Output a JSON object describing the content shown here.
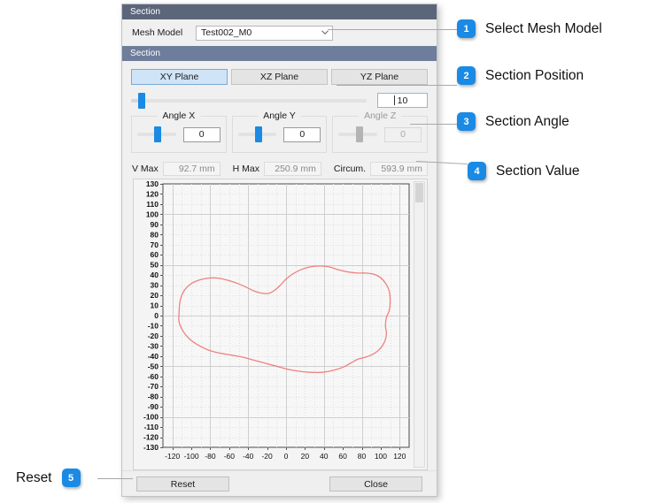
{
  "dialog": {
    "header_1": "Section",
    "header_2": "Section",
    "mesh_model": {
      "label": "Mesh Model",
      "value": "Test002_M0",
      "caret_icon": "chevron-down-icon"
    },
    "tabs": [
      {
        "label": "XY Plane",
        "active": true
      },
      {
        "label": "XZ Plane",
        "active": false
      },
      {
        "label": "YZ Plane",
        "active": false
      }
    ],
    "position": {
      "value": "10",
      "slider_percent": 3
    },
    "angles": [
      {
        "label": "Angle X",
        "value": "0",
        "slider_percent": 46,
        "disabled": false
      },
      {
        "label": "Angle Y",
        "value": "0",
        "slider_percent": 46,
        "disabled": false
      },
      {
        "label": "Angle Z",
        "value": "0",
        "slider_percent": 46,
        "disabled": true
      }
    ],
    "readouts": [
      {
        "label": "V Max",
        "value": "92.7 mm"
      },
      {
        "label": "H Max",
        "value": "250.9 mm"
      },
      {
        "label": "Circum.",
        "value": "593.9 mm"
      }
    ],
    "buttons": {
      "reset": "Reset",
      "close": "Close"
    }
  },
  "callouts": [
    {
      "number": "1",
      "text": "Select Mesh Model"
    },
    {
      "number": "2",
      "text": "Section Position"
    },
    {
      "number": "3",
      "text": "Section Angle"
    },
    {
      "number": "4",
      "text": "Section Value"
    },
    {
      "number": "5",
      "text": "Reset"
    }
  ],
  "colors": {
    "accent": "#1a8ae5",
    "header_dark": "#5c667b",
    "header_mid": "#6e7d9b",
    "tab_active": "#cfe4f7",
    "curve": "#f08080"
  },
  "chart_data": {
    "type": "line",
    "title": "",
    "xlabel": "",
    "ylabel": "",
    "xlim": [
      -130,
      130
    ],
    "ylim": [
      -130,
      130
    ],
    "grid": true,
    "legend": null,
    "x_ticks": [
      -120,
      -100,
      -80,
      -60,
      -40,
      -20,
      0,
      20,
      40,
      60,
      80,
      100,
      120
    ],
    "y_ticks": [
      130,
      120,
      110,
      100,
      90,
      80,
      70,
      60,
      50,
      40,
      30,
      20,
      10,
      0,
      -10,
      -20,
      -30,
      -40,
      -50,
      -60,
      -70,
      -80,
      -90,
      -100,
      -110,
      -120,
      -130
    ],
    "series": [
      {
        "name": "Section outline",
        "closed": true,
        "color": "#f08080",
        "points": [
          [
            -113,
            2
          ],
          [
            -112,
            14
          ],
          [
            -108,
            24
          ],
          [
            -101,
            31
          ],
          [
            -92,
            35
          ],
          [
            -82,
            37
          ],
          [
            -72,
            37
          ],
          [
            -62,
            35
          ],
          [
            -52,
            32
          ],
          [
            -42,
            28
          ],
          [
            -33,
            24
          ],
          [
            -25,
            22
          ],
          [
            -18,
            22
          ],
          [
            -12,
            25
          ],
          [
            -6,
            30
          ],
          [
            0,
            36
          ],
          [
            7,
            41
          ],
          [
            15,
            45
          ],
          [
            25,
            48
          ],
          [
            36,
            49
          ],
          [
            46,
            48
          ],
          [
            56,
            45
          ],
          [
            66,
            43
          ],
          [
            76,
            42
          ],
          [
            84,
            42
          ],
          [
            92,
            41
          ],
          [
            99,
            38
          ],
          [
            105,
            32
          ],
          [
            109,
            24
          ],
          [
            110,
            14
          ],
          [
            109,
            5
          ],
          [
            106,
            -2
          ],
          [
            105,
            -10
          ],
          [
            106,
            -18
          ],
          [
            104,
            -26
          ],
          [
            99,
            -33
          ],
          [
            92,
            -38
          ],
          [
            84,
            -41
          ],
          [
            76,
            -43
          ],
          [
            68,
            -47
          ],
          [
            60,
            -51
          ],
          [
            50,
            -54
          ],
          [
            38,
            -56
          ],
          [
            26,
            -56
          ],
          [
            14,
            -55
          ],
          [
            2,
            -53
          ],
          [
            -10,
            -50
          ],
          [
            -22,
            -47
          ],
          [
            -34,
            -44
          ],
          [
            -46,
            -41
          ],
          [
            -58,
            -39
          ],
          [
            -70,
            -37
          ],
          [
            -82,
            -34
          ],
          [
            -93,
            -29
          ],
          [
            -102,
            -23
          ],
          [
            -109,
            -15
          ],
          [
            -113,
            -6
          ],
          [
            -113,
            2
          ]
        ]
      }
    ]
  }
}
